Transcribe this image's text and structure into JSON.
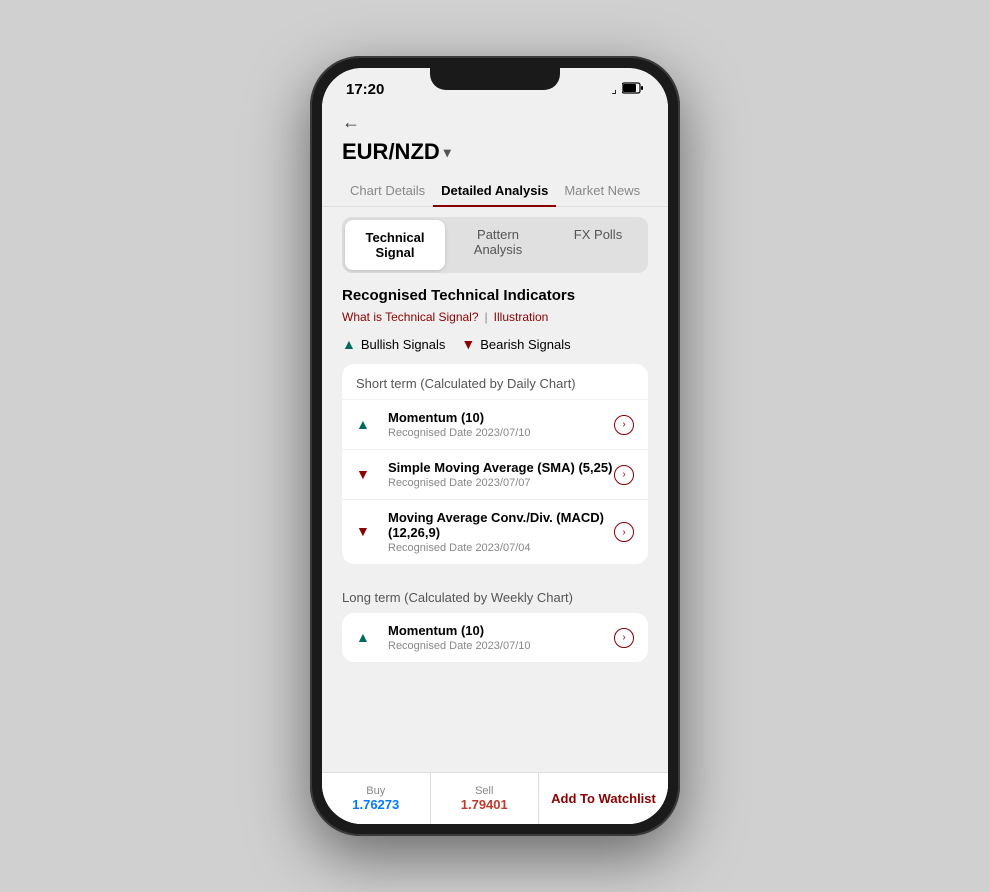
{
  "status": {
    "time": "17:20",
    "wifi": "📶",
    "battery": "75"
  },
  "header": {
    "back_label": "←",
    "currency": "EUR/NZD",
    "chevron": "∨"
  },
  "main_tabs": [
    {
      "id": "chart-details",
      "label": "Chart Details",
      "active": false
    },
    {
      "id": "detailed-analysis",
      "label": "Detailed Analysis",
      "active": true
    },
    {
      "id": "market-news",
      "label": "Market News",
      "active": false
    }
  ],
  "sub_tabs": [
    {
      "id": "technical-signal",
      "label": "Technical Signal",
      "active": true
    },
    {
      "id": "pattern-analysis",
      "label": "Pattern Analysis",
      "active": false
    },
    {
      "id": "fx-polls",
      "label": "FX Polls",
      "active": false
    }
  ],
  "section": {
    "title": "Recognised Technical Indicators",
    "link1": "What is Technical Signal?",
    "divider": "|",
    "link2": "Illustration"
  },
  "legend": {
    "bullish_label": "Bullish Signals",
    "bearish_label": "Bearish Signals"
  },
  "short_term": {
    "group_title": "Short term (Calculated by Daily Chart)",
    "indicators": [
      {
        "name": "Momentum (10)",
        "date": "Recognised Date 2023/07/10",
        "direction": "up"
      },
      {
        "name": "Simple Moving Average (SMA) (5,25)",
        "date": "Recognised Date 2023/07/07",
        "direction": "down"
      },
      {
        "name": "Moving Average Conv./Div. (MACD) (12,26,9)",
        "date": "Recognised Date 2023/07/04",
        "direction": "down"
      }
    ]
  },
  "long_term": {
    "group_title": "Long term (Calculated by Weekly Chart)",
    "indicators": [
      {
        "name": "Momentum (10)",
        "date": "Recognised Date 2023/07/10",
        "direction": "up"
      }
    ]
  },
  "bottom_bar": {
    "buy_label": "Buy",
    "buy_value": "1.76273",
    "sell_label": "Sell",
    "sell_value": "1.79401",
    "watchlist_label": "Add To Watchlist"
  }
}
